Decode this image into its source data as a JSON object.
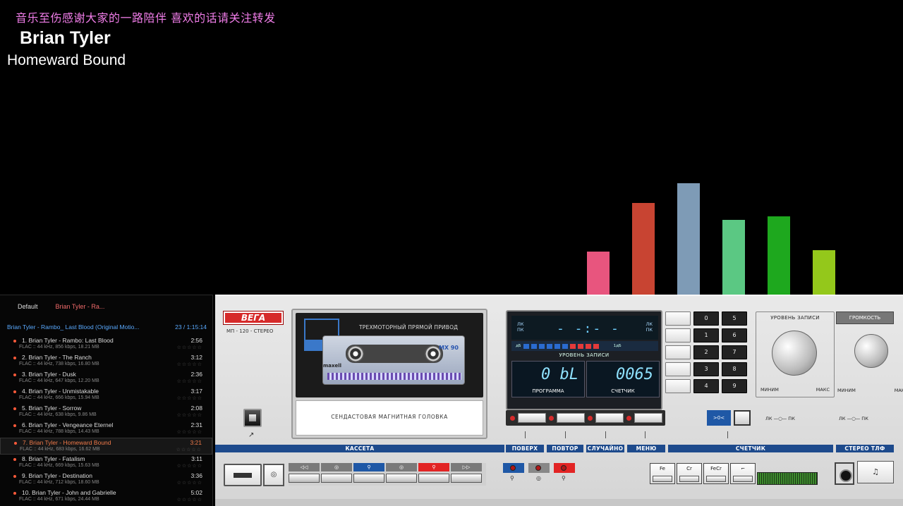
{
  "banner": "音乐至伤感谢大家的一路陪伴 喜欢的话请关注转发",
  "now_playing": {
    "artist": "Brian Tyler",
    "title": "Homeward Bound"
  },
  "visualizer": {
    "bars": [
      {
        "level": 0.37,
        "color": "#e8557e"
      },
      {
        "level": 0.79,
        "color": "#c84432"
      },
      {
        "level": 0.96,
        "color": "#7e9bb6"
      },
      {
        "level": 0.64,
        "color": "#5bc883"
      },
      {
        "level": 0.67,
        "color": "#1ea81e"
      },
      {
        "level": 0.38,
        "color": "#94c81b"
      }
    ]
  },
  "playlist": {
    "tabs": [
      "Default",
      "Brian Tyler - Ra..."
    ],
    "header": "Brian Tyler - Rambo_ Last Blood (Original Motio...",
    "header_meta": "23 / 1:15:14",
    "items": [
      {
        "title": "1. Brian Tyler - Rambo: Last Blood",
        "duration": "2:56",
        "meta": "FLAC :: 44 kHz, 856 kbps, 18.21 MB"
      },
      {
        "title": "2. Brian Tyler - The Ranch",
        "duration": "3:12",
        "meta": "FLAC :: 44 kHz, 738 kbps, 16.80 MB"
      },
      {
        "title": "3. Brian Tyler - Dusk",
        "duration": "2:36",
        "meta": "FLAC :: 44 kHz, 647 kbps, 12.20 MB"
      },
      {
        "title": "4. Brian Tyler - Unmistakable",
        "duration": "3:17",
        "meta": "FLAC :: 44 kHz, 666 kbps, 15.94 MB"
      },
      {
        "title": "5. Brian Tyler - Sorrow",
        "duration": "2:08",
        "meta": "FLAC :: 44 kHz, 638 kbps, 9.86 MB"
      },
      {
        "title": "6. Brian Tyler - Vengeance Eternel",
        "duration": "2:31",
        "meta": "FLAC :: 44 kHz, 788 kbps, 14.43 MB"
      },
      {
        "title": "7. Brian Tyler - Homeward Bound",
        "duration": "3:21",
        "meta": "FLAC :: 44 kHz, 683 kbps, 16.62 MB",
        "current": true
      },
      {
        "title": "8. Brian Tyler - Fatalism",
        "duration": "3:11",
        "meta": "FLAC :: 44 kHz, 669 kbps, 15.63 MB"
      },
      {
        "title": "9. Brian Tyler - Destination",
        "duration": "3:36",
        "meta": "FLAC :: 44 kHz, 712 kbps, 18.60 MB"
      },
      {
        "title": "10. Brian Tyler - John and Gabrielle",
        "duration": "5:02",
        "meta": "FLAC :: 44 kHz, 671 kbps, 24.44 MB"
      }
    ],
    "stars": "☆☆☆☆☆"
  },
  "deck": {
    "brand": "BEГA",
    "model": "МП - 120 - СТЕРЕО",
    "cassette_title": "ТРЕХМОТОРНЫЙ ПРЯМОЙ ПРИВОД",
    "cassette_brand": "maxell",
    "cassette_type": "MX 90",
    "head_label": "СЕНДАСТОВАЯ   МАГНИТНАЯ   ГОЛОВКА",
    "display": {
      "lk": "ЛК\nПК",
      "pk": "ЛК\nПК",
      "dashes": "- -:- -",
      "meter_caption": "УРОВЕНЬ ЗАПИСИ",
      "meter_left": "дБ",
      "meter_right": "1дБ",
      "program_value": "0 bL",
      "program_label": "ПРОГРАММА",
      "counter_value": "0065",
      "counter_label": "СЧЕТЧИК"
    },
    "keypad": [
      "",
      "0",
      "5",
      "",
      "1",
      "6",
      "",
      "2",
      "7",
      "",
      "3",
      "8",
      "",
      "4",
      "9"
    ],
    "rec_level": {
      "title": "УРОВЕНЬ ЗАПИСИ",
      "min": "МИНИМ",
      "max": "МАКС"
    },
    "volume": {
      "title": "ГРОМКОСТЬ",
      "min": "МИНИМ",
      "max": "МАКС"
    },
    "counter_btn": ">0<",
    "lk_pk_1": "ЛК —○— ПК",
    "lk_pk_2": "ЛК —○— ПК",
    "sections": {
      "cassette": "КАССЕТА",
      "repeat_top": "ПОВЕРХ",
      "repeat": "ПОВТОР",
      "random": "СЛУЧАЙНО",
      "menu": "МЕНЮ",
      "counter": "СЧЕТЧИК",
      "stereo_phones": "СТЕРЕО ТЛФ"
    },
    "transport_labels": [
      "◁◁",
      "◎",
      "⚲",
      "◎",
      "⚲",
      "▷▷"
    ],
    "tape_types": [
      "Fe",
      "Cr",
      "FeCr",
      "⌐"
    ],
    "rec_symbol": "◎",
    "phones_symbol": "♫",
    "eject_symbol": "↗"
  }
}
